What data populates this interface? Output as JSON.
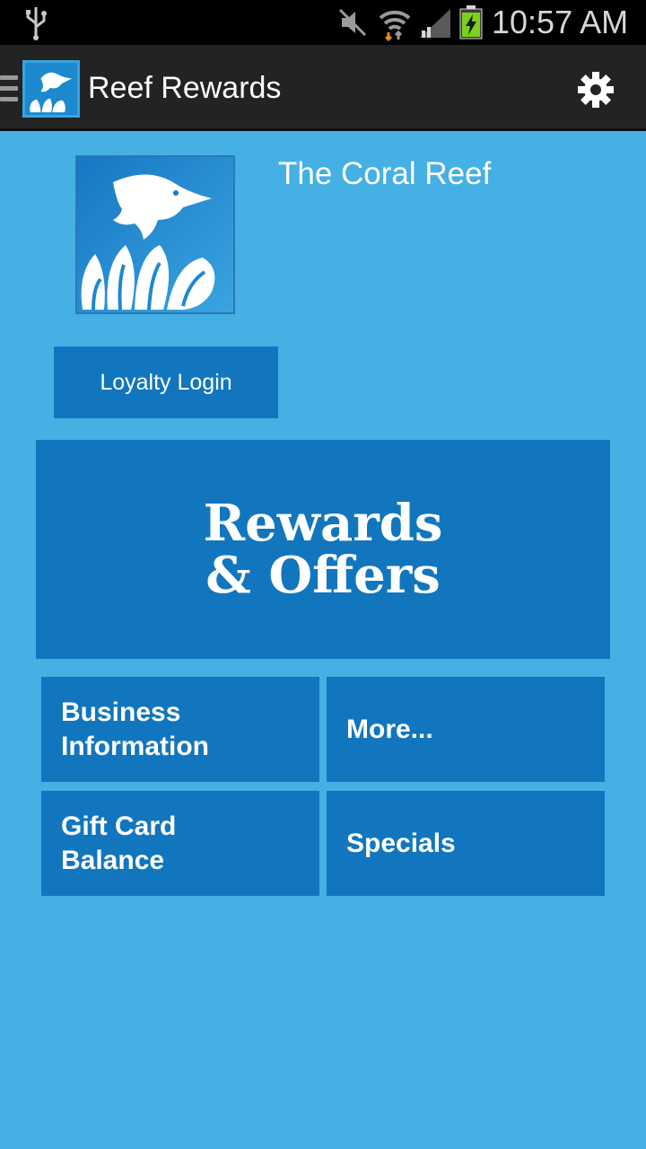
{
  "status_bar": {
    "time": "10:57 AM",
    "icons": [
      "usb-icon",
      "mute-icon",
      "wifi-icon",
      "signal-icon",
      "battery-charging-icon"
    ]
  },
  "action_bar": {
    "title": "Reef Rewards",
    "icons": [
      "drawer-menu-icon",
      "app-logo-icon",
      "settings-gear-icon"
    ]
  },
  "business": {
    "name": "The Coral Reef",
    "logo_icon": "fish-coral-logo"
  },
  "login_button": {
    "label": "Loyalty Login"
  },
  "rewards_button": {
    "line1": "Rewards",
    "line2": "& Offers"
  },
  "tiles": [
    {
      "line1": "Business",
      "line2": "Information"
    },
    {
      "line1": "More...",
      "line2": ""
    },
    {
      "line1": "Gift Card",
      "line2": "Balance"
    },
    {
      "line1": "Specials",
      "line2": ""
    }
  ],
  "colors": {
    "background": "#45b0e4",
    "tile": "#1176be",
    "action_bar": "#232323",
    "status_bar": "#000000"
  }
}
